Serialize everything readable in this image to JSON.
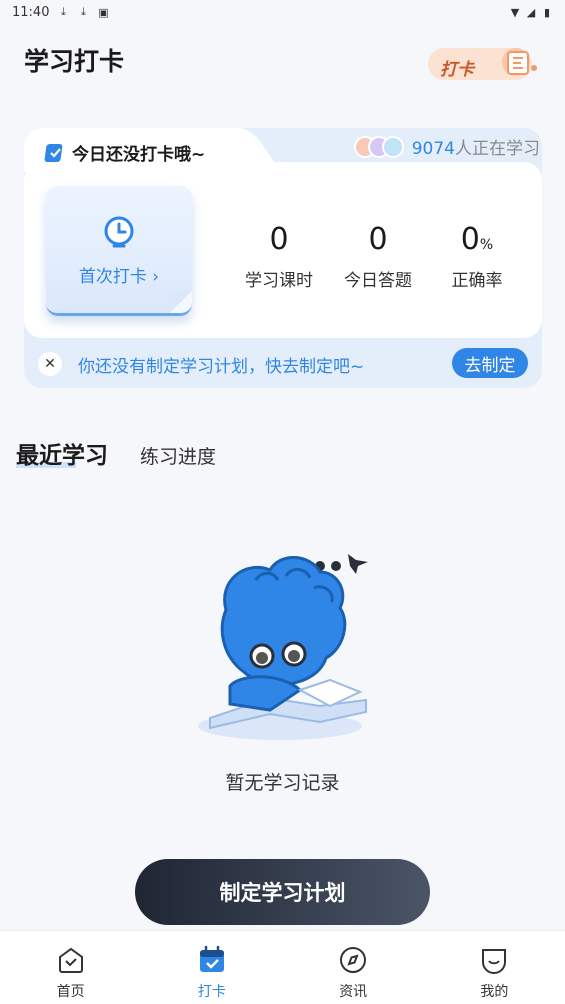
{
  "status_bar": {
    "time": "11:40"
  },
  "header": {
    "title": "学习打卡",
    "badge_text": "打卡"
  },
  "checkin_card": {
    "tag_text": "今日还没打卡哦~",
    "learning_count": "9074",
    "learning_suffix": "人正在学习",
    "first_checkin": "首次打卡 ›",
    "stats": [
      {
        "value": "0",
        "label": "学习课时"
      },
      {
        "value": "0",
        "label": "今日答题"
      },
      {
        "value": "0",
        "unit": "%",
        "label": "正确率"
      }
    ],
    "plan_text": "你还没有制定学习计划，快去制定吧~",
    "plan_button": "去制定"
  },
  "tabs": {
    "recent": "最近学习",
    "progress": "练习进度"
  },
  "empty_text": "暂无学习记录",
  "cta": "制定学习计划",
  "nav": [
    {
      "label": "首页",
      "icon": "home-icon"
    },
    {
      "label": "打卡",
      "icon": "calendar-check-icon"
    },
    {
      "label": "资讯",
      "icon": "compass-icon"
    },
    {
      "label": "我的",
      "icon": "profile-icon"
    }
  ],
  "colors": {
    "accent": "#2f86e6",
    "cta_dark": "#1f2533"
  }
}
